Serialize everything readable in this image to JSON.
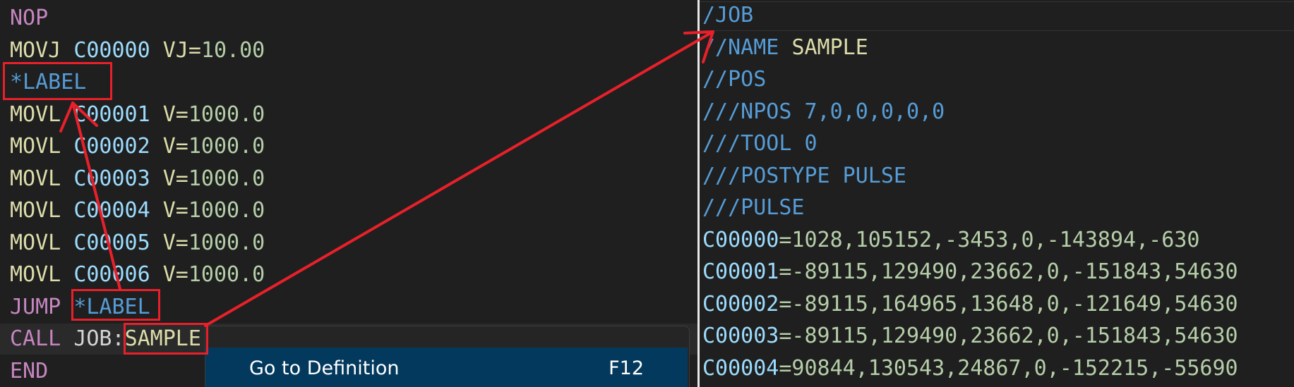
{
  "left_editor": {
    "lines": [
      [
        {
          "t": "NOP",
          "c": "kw-purple"
        }
      ],
      [
        {
          "t": "MOVJ ",
          "c": "kw-yellow"
        },
        {
          "t": "C00000",
          "c": "kw-cyan"
        },
        {
          "t": " VJ=",
          "c": "kw-yellow"
        },
        {
          "t": "10.00",
          "c": "kw-green"
        }
      ],
      [
        {
          "t": "*LABEL",
          "c": "kw-blue"
        }
      ],
      [
        {
          "t": "MOVL ",
          "c": "kw-yellow"
        },
        {
          "t": "C00001",
          "c": "kw-cyan"
        },
        {
          "t": " V=",
          "c": "kw-yellow"
        },
        {
          "t": "1000.0",
          "c": "kw-green"
        }
      ],
      [
        {
          "t": "MOVL ",
          "c": "kw-yellow"
        },
        {
          "t": "C00002",
          "c": "kw-cyan"
        },
        {
          "t": " V=",
          "c": "kw-yellow"
        },
        {
          "t": "1000.0",
          "c": "kw-green"
        }
      ],
      [
        {
          "t": "MOVL ",
          "c": "kw-yellow"
        },
        {
          "t": "C00003",
          "c": "kw-cyan"
        },
        {
          "t": " V=",
          "c": "kw-yellow"
        },
        {
          "t": "1000.0",
          "c": "kw-green"
        }
      ],
      [
        {
          "t": "MOVL ",
          "c": "kw-yellow"
        },
        {
          "t": "C00004",
          "c": "kw-cyan"
        },
        {
          "t": " V=",
          "c": "kw-yellow"
        },
        {
          "t": "1000.0",
          "c": "kw-green"
        }
      ],
      [
        {
          "t": "MOVL ",
          "c": "kw-yellow"
        },
        {
          "t": "C00005",
          "c": "kw-cyan"
        },
        {
          "t": " V=",
          "c": "kw-yellow"
        },
        {
          "t": "1000.0",
          "c": "kw-green"
        }
      ],
      [
        {
          "t": "MOVL ",
          "c": "kw-yellow"
        },
        {
          "t": "C00006",
          "c": "kw-cyan"
        },
        {
          "t": " V=",
          "c": "kw-yellow"
        },
        {
          "t": "1000.0",
          "c": "kw-green"
        }
      ],
      [
        {
          "t": "JUMP ",
          "c": "kw-purple"
        },
        {
          "t": "*LABEL",
          "c": "kw-blue"
        }
      ],
      [
        {
          "t": "CALL ",
          "c": "kw-purple"
        },
        {
          "t": "JOB:",
          "c": "kw-white"
        },
        {
          "t": "SAMPLE",
          "c": "kw-yellow"
        }
      ],
      [
        {
          "t": "END",
          "c": "kw-purple"
        }
      ]
    ]
  },
  "right_editor": {
    "lines": [
      [
        {
          "t": "/JOB",
          "c": "kw-blue"
        }
      ],
      [
        {
          "t": "//NAME ",
          "c": "kw-blue"
        },
        {
          "t": "SAMPLE",
          "c": "kw-yellow"
        }
      ],
      [
        {
          "t": "//POS",
          "c": "kw-blue"
        }
      ],
      [
        {
          "t": "///NPOS 7,0,0,0,0,0",
          "c": "kw-blue"
        }
      ],
      [
        {
          "t": "///TOOL 0",
          "c": "kw-blue"
        }
      ],
      [
        {
          "t": "///POSTYPE PULSE",
          "c": "kw-blue"
        }
      ],
      [
        {
          "t": "///PULSE",
          "c": "kw-blue"
        }
      ],
      [
        {
          "t": "C00000",
          "c": "kw-cyan"
        },
        {
          "t": "=1028,105152,-3453,0,-143894,-630",
          "c": "kw-green"
        }
      ],
      [
        {
          "t": "C00001",
          "c": "kw-cyan"
        },
        {
          "t": "=-89115,129490,23662,0,-151843,54630",
          "c": "kw-green"
        }
      ],
      [
        {
          "t": "C00002",
          "c": "kw-cyan"
        },
        {
          "t": "=-89115,164965,13648,0,-121649,54630",
          "c": "kw-green"
        }
      ],
      [
        {
          "t": "C00003",
          "c": "kw-cyan"
        },
        {
          "t": "=-89115,129490,23662,0,-151843,54630",
          "c": "kw-green"
        }
      ],
      [
        {
          "t": "C00004",
          "c": "kw-cyan"
        },
        {
          "t": "=90844,130543,24867,0,-152215,-55690",
          "c": "kw-green"
        }
      ]
    ]
  },
  "context_menu": {
    "item_label": "Go to Definition",
    "item_shortcut": "F12"
  },
  "colors": {
    "background": "#1f1f1f",
    "annotation_red": "#e8202a",
    "menu_highlight": "#04395e"
  }
}
